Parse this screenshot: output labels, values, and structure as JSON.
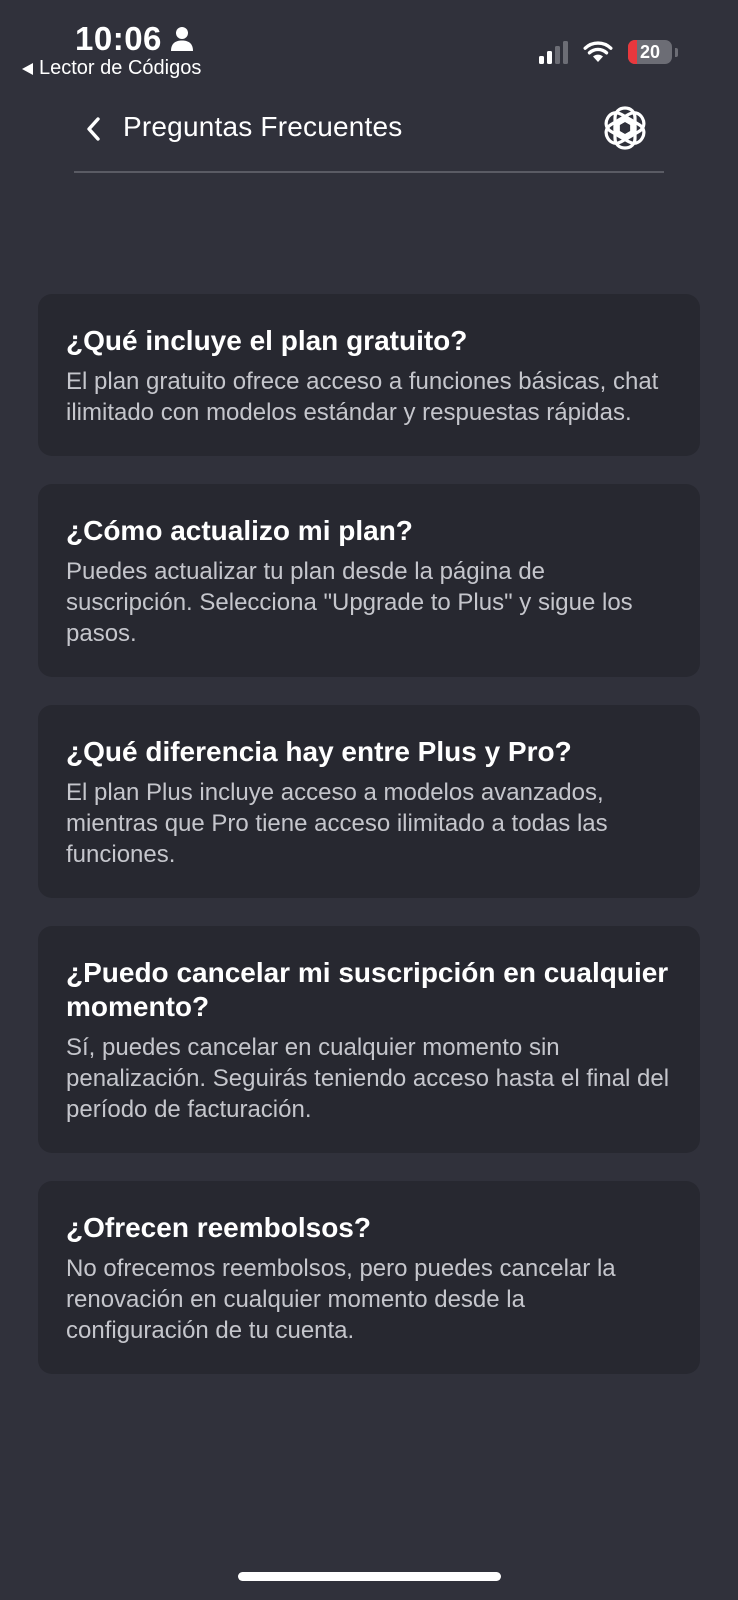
{
  "status_bar": {
    "time": "10:06",
    "back_app_label": "Lector de Códigos",
    "battery_level": "20",
    "icons": [
      "person-icon",
      "signal-icon",
      "wifi-icon",
      "battery-icon"
    ]
  },
  "header": {
    "title": "Preguntas Frecuentes",
    "back_icon": "chevron-left-icon",
    "logo_icon": "openai-logo-icon"
  },
  "faqs": [
    {
      "question": "¿Qué incluye el plan gratuito?",
      "answer": "El plan gratuito ofrece acceso a funciones básicas, chat ilimitado con modelos estándar y respuestas rápidas."
    },
    {
      "question": "¿Cómo actualizo mi plan?",
      "answer": "Puedes actualizar tu plan desde la página de suscripción. Selecciona \"Upgrade to Plus\" y sigue los pasos."
    },
    {
      "question": "¿Qué diferencia hay entre Plus y Pro?",
      "answer": "El plan Plus incluye acceso a modelos avanzados, mientras que Pro tiene acceso ilimitado a todas las funciones."
    },
    {
      "question": "¿Puedo cancelar mi suscripción en cualquier momento?",
      "answer": "Sí, puedes cancelar en cualquier momento sin penalización. Seguirás teniendo acceso hasta el final del período de facturación."
    },
    {
      "question": "¿Ofrecen reembolsos?",
      "answer": "No ofrecemos reembolsos, pero puedes cancelar la renovación en cualquier momento desde la configuración de tu cuenta."
    }
  ],
  "colors": {
    "background": "#30313b",
    "card": "#272830",
    "text_primary": "#ffffff",
    "text_secondary": "#c5c6cc",
    "battery_low": "#e8383d"
  }
}
